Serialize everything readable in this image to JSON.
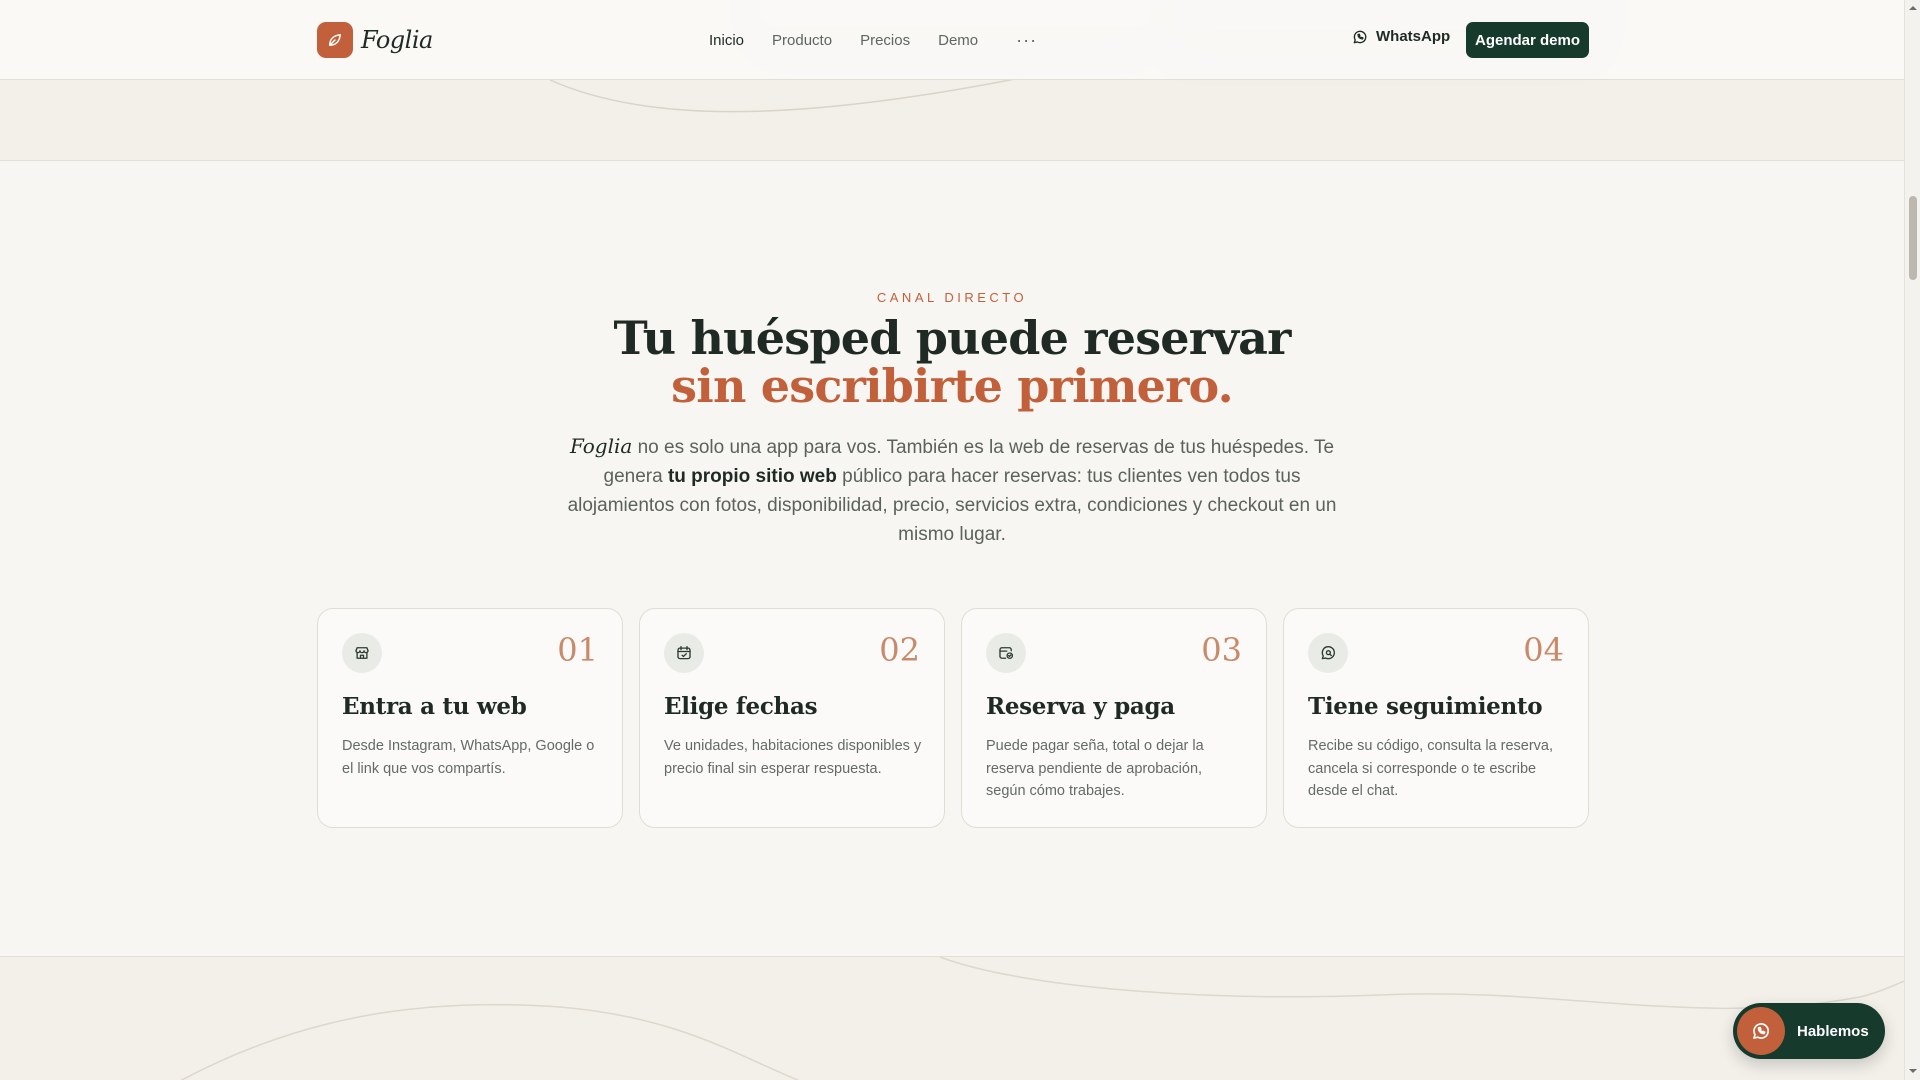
{
  "header": {
    "brand": "Foglia",
    "nav": [
      {
        "label": "Inicio",
        "active": true
      },
      {
        "label": "Producto"
      },
      {
        "label": "Precios"
      },
      {
        "label": "Demo"
      }
    ],
    "more_label": "···",
    "whatsapp_label": "WhatsApp",
    "cta_label": "Agendar demo"
  },
  "section": {
    "eyebrow": "CANAL DIRECTO",
    "headline_line1": "Tu huésped puede reservar",
    "headline_line2": "sin escribirte primero.",
    "lede": {
      "brand": "Foglia",
      "part1": " no es solo una app para vos. También es la web de reservas de tus huéspedes. Te genera ",
      "bold": "tu propio sitio web",
      "part2": " público para hacer reservas: tus clientes ven todos tus alojamientos con fotos, disponibilidad, precio, servicios extra, condiciones y checkout en un mismo lugar."
    },
    "cards": [
      {
        "num": "01",
        "title": "Entra a tu web",
        "desc": "Desde Instagram, WhatsApp, Google o el link que vos compartís.",
        "icon": "storefront-icon"
      },
      {
        "num": "02",
        "title": "Elige fechas",
        "desc": "Ve unidades, habitaciones disponibles y precio final sin esperar respuesta.",
        "icon": "calendar-icon"
      },
      {
        "num": "03",
        "title": "Reserva y paga",
        "desc": "Puede pagar seña, total o dejar la reserva pendiente de aprobación, según cómo trabajes.",
        "icon": "wallet-check-icon"
      },
      {
        "num": "04",
        "title": "Tiene seguimiento",
        "desc": "Recibe su código, consulta la reserva, cancela si corresponde o te escribe desde el chat.",
        "icon": "chat-search-icon"
      }
    ]
  },
  "chat_fab": {
    "label": "Hablemos"
  },
  "colors": {
    "accent": "#c1603b",
    "dark_green": "#163a2c",
    "background": "#f8f6f2"
  }
}
